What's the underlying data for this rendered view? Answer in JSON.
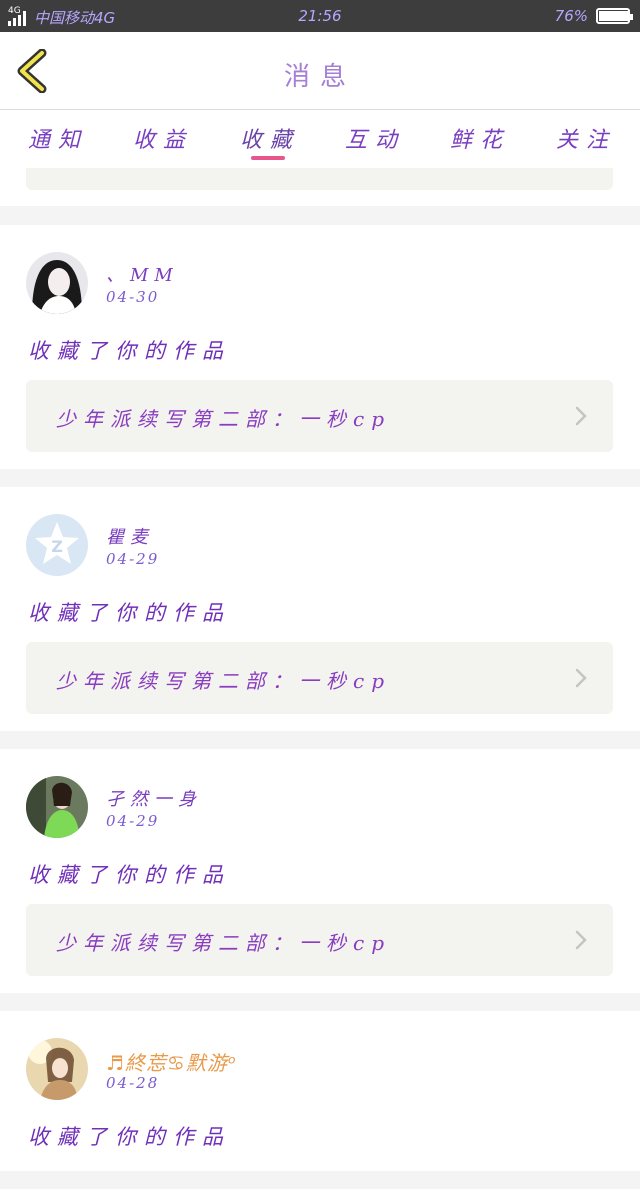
{
  "status_bar": {
    "network": "4G",
    "carrier": "中国移动4G",
    "time": "21:56",
    "battery": "76%",
    "battery_level": 0.76
  },
  "header": {
    "title": "消息"
  },
  "tabs": [
    {
      "label": "通知"
    },
    {
      "label": "收益"
    },
    {
      "label": "收藏"
    },
    {
      "label": "互动"
    },
    {
      "label": "鲜花"
    },
    {
      "label": "关注"
    }
  ],
  "active_tab": "收藏",
  "items": [
    {
      "name": "、MM",
      "date": "04-30",
      "action": "收藏了你的作品",
      "work_title": "少年派续写第二部：一秒cp"
    },
    {
      "name": "瞿麦",
      "date": "04-29",
      "action": "收藏了你的作品",
      "work_title": "少年派续写第二部：一秒cp"
    },
    {
      "name": "孑然一身",
      "date": "04-29",
      "action": "收藏了你的作品",
      "work_title": "少年派续写第二部：一秒cp"
    },
    {
      "name": "♬終莣♋默游ᵒ",
      "date": "04-28",
      "action": "收藏了你的作品",
      "work_title": ""
    }
  ],
  "colors": {
    "accent_pink": "#e8558a",
    "text_purple": "#7a3ec0",
    "card_bg": "#f3f3ef"
  }
}
